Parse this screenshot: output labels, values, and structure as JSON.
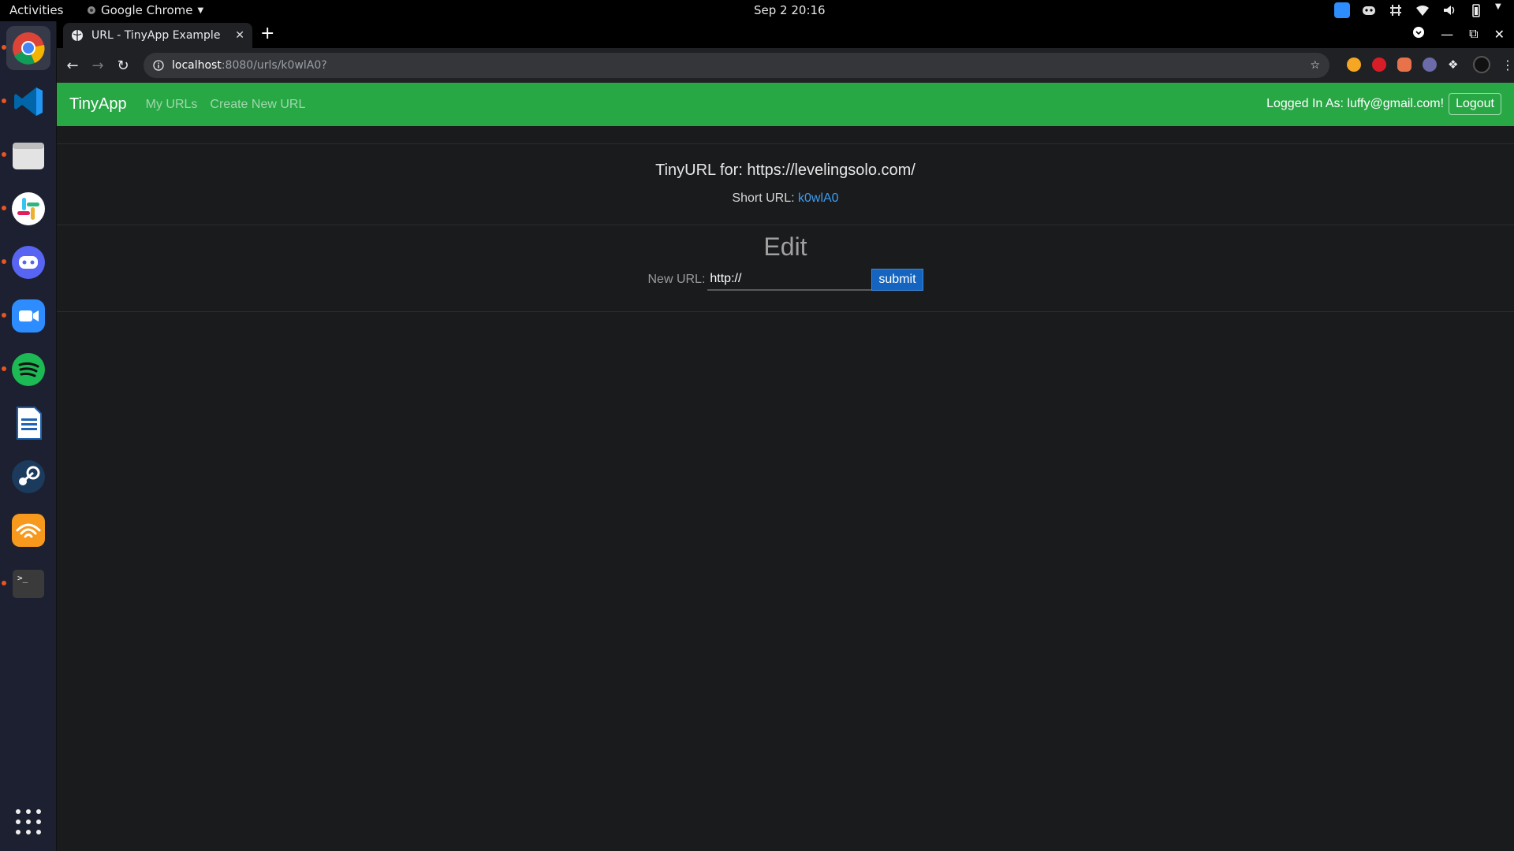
{
  "topbar": {
    "activities": "Activities",
    "app_name": "Google Chrome",
    "clock": "Sep 2  20:16"
  },
  "dock": {
    "items": [
      "chrome",
      "vscode",
      "files",
      "slack",
      "discord",
      "zoom",
      "spotify",
      "libreoffice-writer",
      "steam",
      "audible",
      "terminal"
    ]
  },
  "browser": {
    "tab_title": "URL - TinyApp Example",
    "url_host": "localhost",
    "url_path": ":8080/urls/k0wlA0?"
  },
  "navbar": {
    "brand": "TinyApp",
    "links": [
      "My URLs",
      "Create New URL"
    ],
    "logged_in": "Logged In As: luffy@gmail.com!",
    "logout": "Logout",
    "bg_color": "#28a745"
  },
  "card": {
    "title": "TinyURL for: https://levelingsolo.com/",
    "short_label": "Short URL:",
    "short_value": "k0wlA0",
    "edit_heading": "Edit",
    "new_url_label": "New URL:",
    "new_url_value": "http://",
    "submit": "submit"
  }
}
